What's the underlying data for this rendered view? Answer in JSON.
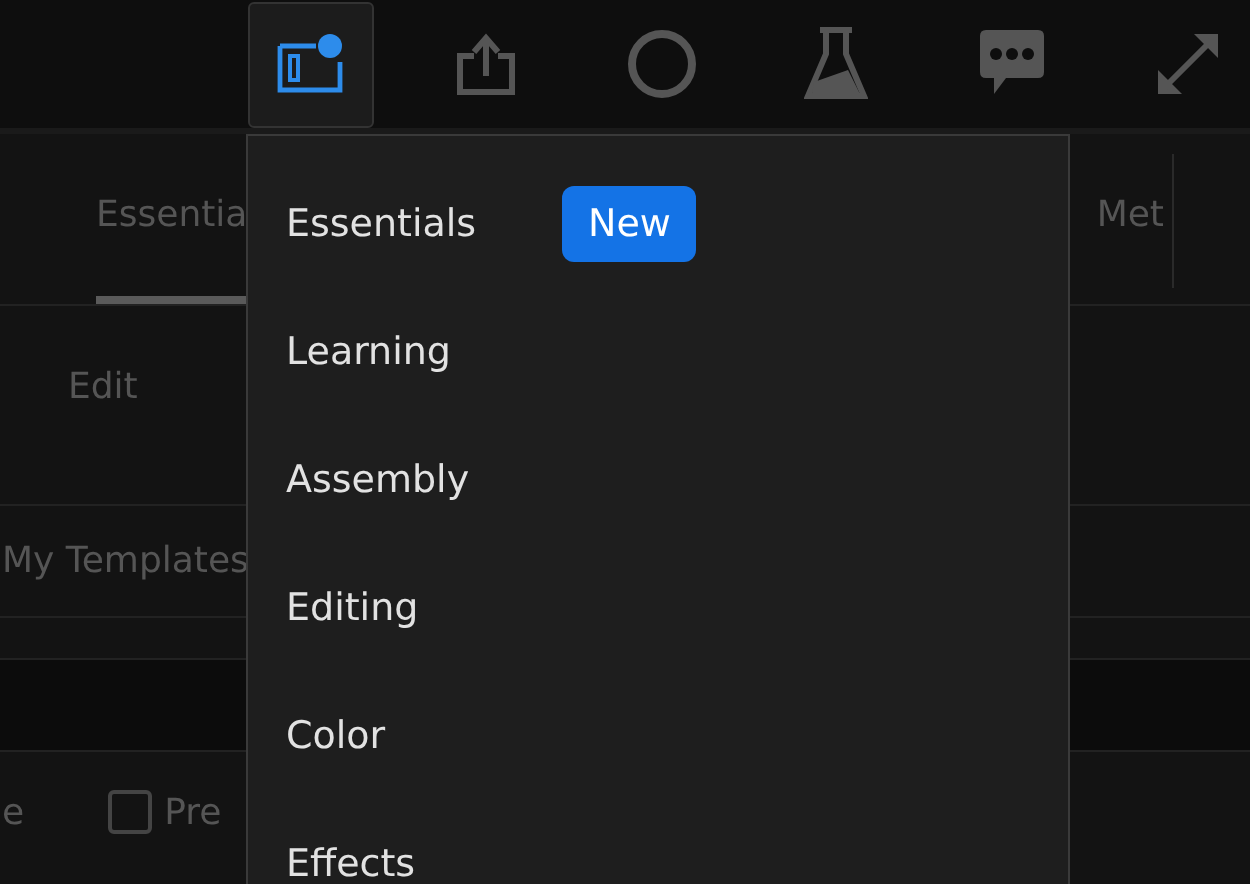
{
  "toolbar": {
    "buttons": [
      {
        "kind": "workspaces",
        "selected": true
      },
      {
        "kind": "share",
        "selected": false
      },
      {
        "kind": "circle",
        "selected": false
      },
      {
        "kind": "flask",
        "selected": false
      },
      {
        "kind": "chat",
        "selected": false
      },
      {
        "kind": "expand",
        "selected": false
      }
    ]
  },
  "panel": {
    "tabs": [
      {
        "label": "Essentia",
        "selected": true
      },
      {
        "label": "Met",
        "selected": false
      }
    ],
    "edit_label": "Edit",
    "templates_label": "My Templates",
    "option": {
      "prefix": "e",
      "checkbox_label": "Pre",
      "checked": false
    }
  },
  "menu": {
    "items": [
      {
        "label": "Essentials",
        "badge": "New"
      },
      {
        "label": "Learning"
      },
      {
        "label": "Assembly"
      },
      {
        "label": "Editing"
      },
      {
        "label": "Color"
      },
      {
        "label": "Effects"
      }
    ]
  }
}
